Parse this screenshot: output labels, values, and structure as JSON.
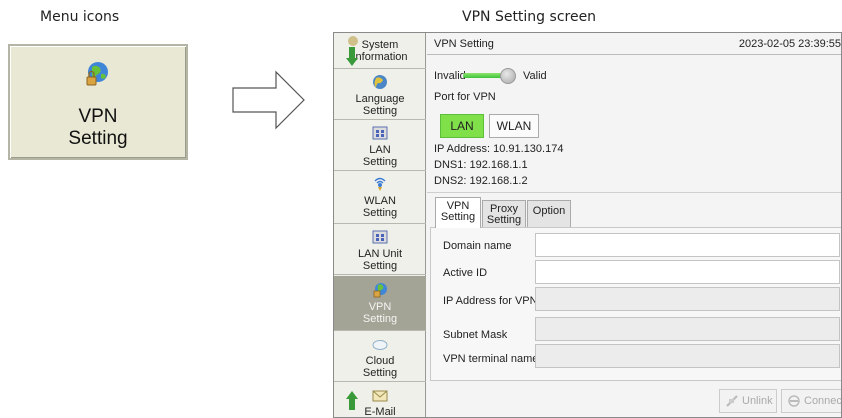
{
  "captions": {
    "left": "Menu icons",
    "right": "VPN Setting screen"
  },
  "menu_tile": {
    "label": "VPN\nSetting",
    "icon": "vpn-globe-icon"
  },
  "sidebar": {
    "items": [
      {
        "label": "System\nInformation",
        "icon": "info-icon"
      },
      {
        "label": "Language\nSetting",
        "icon": "language-icon"
      },
      {
        "label": "LAN\nSetting",
        "icon": "lan-icon"
      },
      {
        "label": "WLAN\nSetting",
        "icon": "wlan-icon"
      },
      {
        "label": "LAN Unit\nSetting",
        "icon": "lan-unit-icon"
      },
      {
        "label": "VPN\nSetting",
        "icon": "vpn-globe-icon",
        "active": true
      },
      {
        "label": "Cloud\nSetting",
        "icon": "cloud-icon"
      },
      {
        "label": "E-Mail",
        "icon": "email-icon"
      }
    ]
  },
  "screen": {
    "title": "VPN Setting",
    "datetime": "2023-02-05  23:39:55",
    "toggle": {
      "off_label": "Invalid",
      "on_label": "Valid",
      "state": "valid"
    },
    "port_label": "Port for VPN",
    "port_buttons": {
      "lan": "LAN",
      "wlan": "WLAN",
      "selected": "LAN"
    },
    "ip_address": "IP Address: 10.91.130.174",
    "dns1": "DNS1: 192.168.1.1",
    "dns2": "DNS2: 192.168.1.2",
    "tabs": [
      {
        "label": "VPN\nSetting",
        "selected": true
      },
      {
        "label": "Proxy\nSetting",
        "selected": false
      },
      {
        "label": "Option",
        "selected": false
      }
    ],
    "fields": [
      {
        "label": "Domain name",
        "value": "",
        "enabled": true
      },
      {
        "label": "Active ID",
        "value": "",
        "enabled": true
      },
      {
        "label": "IP Address for VPN",
        "value": "",
        "enabled": false
      },
      {
        "label": "Subnet Mask",
        "value": "",
        "enabled": false
      },
      {
        "label": "VPN terminal name",
        "value": "",
        "enabled": false
      }
    ],
    "footer": {
      "unlink": "Unlink",
      "connect": "Connect"
    }
  },
  "colors": {
    "accent_green": "#7fe04a",
    "sidebar_active": "#a4a496",
    "tile_bg": "#e8e8d4"
  }
}
